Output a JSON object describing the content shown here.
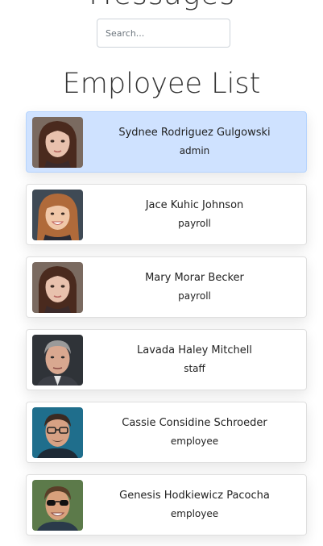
{
  "header": {
    "title": "Messages"
  },
  "search": {
    "placeholder": "Search...",
    "value": ""
  },
  "list": {
    "title": "Employee List",
    "selected_color": "#cfe2ff",
    "employees": [
      {
        "name": "Sydnee Rodriguez Gulgowski",
        "role": "admin",
        "selected": true,
        "avatar": "female-dark-hair-avatar"
      },
      {
        "name": "Jace Kuhic Johnson",
        "role": "payroll",
        "selected": false,
        "avatar": "female-smiling-avatar"
      },
      {
        "name": "Mary Morar Becker",
        "role": "payroll",
        "selected": false,
        "avatar": "female-dark-hair-avatar"
      },
      {
        "name": "Lavada Haley Mitchell",
        "role": "staff",
        "selected": false,
        "avatar": "male-gray-hair-avatar"
      },
      {
        "name": "Cassie Considine Schroeder",
        "role": "employee",
        "selected": false,
        "avatar": "male-glasses-avatar"
      },
      {
        "name": "Genesis Hodkiewicz Pacocha",
        "role": "employee",
        "selected": false,
        "avatar": "male-sunglasses-avatar"
      }
    ]
  }
}
